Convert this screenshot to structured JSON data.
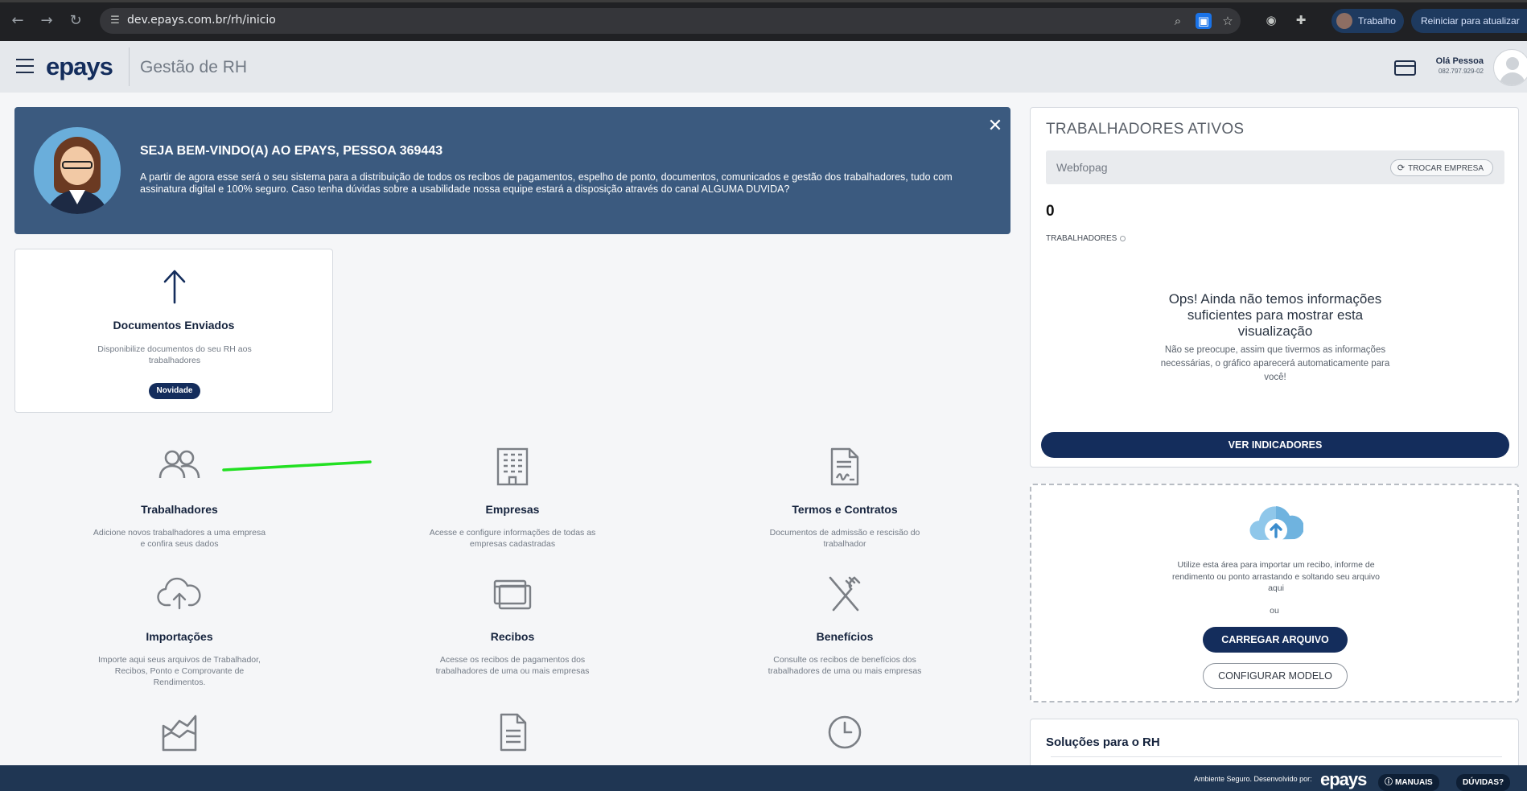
{
  "browser": {
    "url": "dev.epays.com.br/rh/inicio",
    "profile_label": "Trabalho",
    "restart_label": "Reiniciar para atualizar"
  },
  "header": {
    "logo": "epays",
    "app_title": "Gestão de RH",
    "user_name": "Olá Pessoa",
    "user_id": "082.797.929-02"
  },
  "banner": {
    "title": "SEJA BEM-VINDO(A) AO EPAYS, PESSOA 369443",
    "text": "A partir de agora esse será o seu sistema para a distribuição de todos os recibos de pagamentos, espelho de ponto, documentos, comunicados e gestão dos trabalhadores, tudo com assinatura digital e 100% seguro. Caso tenha dúvidas sobre a usabilidade nossa equipe estará a disposição através do canal ALGUMA DUVIDA?"
  },
  "feature_card": {
    "title": "Documentos Enviados",
    "description": "Disponibilize documentos do seu RH aos trabalhadores",
    "badge": "Novidade"
  },
  "grid": [
    {
      "title": "Trabalhadores",
      "description": "Adicione novos trabalhadores a uma empresa e confira seus dados",
      "icon": "users-icon"
    },
    {
      "title": "Empresas",
      "description": "Acesse e configure informações de todas as empresas cadastradas",
      "icon": "building-icon"
    },
    {
      "title": "Termos e Contratos",
      "description": "Documentos de admissão e rescisão do trabalhador",
      "icon": "contract-icon"
    },
    {
      "title": "Importações",
      "description": "Importe aqui seus arquivos de Trabalhador, Recibos, Ponto e Comprovante de Rendimentos.",
      "icon": "cloud-upload-icon"
    },
    {
      "title": "Recibos",
      "description": "Acesse os recibos de pagamentos dos trabalhadores de uma ou mais empresas",
      "icon": "receipts-icon"
    },
    {
      "title": "Benefícios",
      "description": "Consulte os recibos de benefícios dos trabalhadores de uma ou mais empresas",
      "icon": "utensils-icon"
    },
    {
      "title": "",
      "description": "",
      "icon": "chart-area-icon"
    },
    {
      "title": "",
      "description": "",
      "icon": "document-icon"
    },
    {
      "title": "",
      "description": "",
      "icon": "clock-icon"
    }
  ],
  "panel": {
    "title": "TRABALHADORES ATIVOS",
    "company": "Webfopag",
    "switch_button": "TROCAR EMPRESA",
    "count": "0",
    "count_label": "TRABALHADORES",
    "empty_title": "Ops! Ainda não temos informações suficientes para mostrar esta visualização",
    "empty_desc": "Não se preocupe, assim que tivermos as informações necessárias, o gráfico aparecerá automaticamente para você!",
    "button": "VER INDICADORES"
  },
  "upload": {
    "text": "Utilize esta área para importar um recibo, informe de rendimento ou ponto arrastando e soltando seu arquivo aqui",
    "or": "ou",
    "upload_button": "CARREGAR ARQUIVO",
    "config_button": "CONFIGURAR MODELO"
  },
  "solutions": {
    "title": "Soluções para o RH"
  },
  "footer": {
    "text": "Ambiente Seguro. Desenvolvido por:",
    "logo": "epays",
    "manuals": "MANUAIS",
    "help": "DÚVIDAS?"
  },
  "colors": {
    "brand_navy": "#142d5c",
    "banner_bg": "#3b5a7f",
    "footer_bg": "#1f3653",
    "annotation_green": "#22e022"
  }
}
